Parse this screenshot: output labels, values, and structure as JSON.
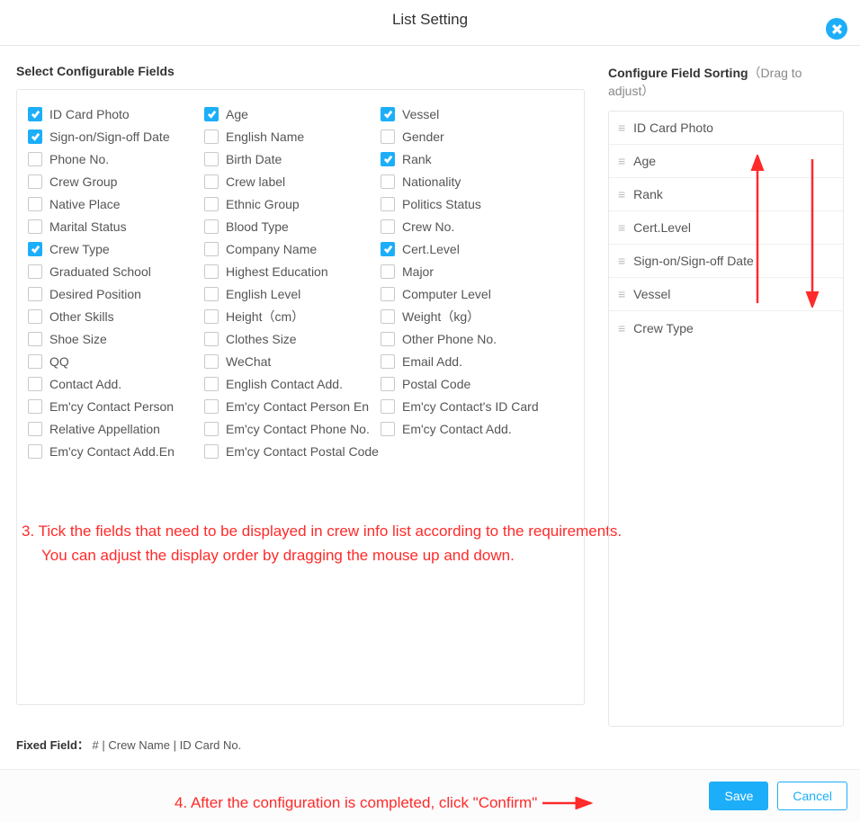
{
  "title": "List Setting",
  "leftPanelTitle": "Select Configurable Fields",
  "rightPanelTitle": "Configure Field Sorting",
  "rightPanelHint": "（Drag to adjust）",
  "columns": [
    [
      {
        "label": "ID Card Photo",
        "checked": true
      },
      {
        "label": "Sign-on/Sign-off Date",
        "checked": true
      },
      {
        "label": "Phone No.",
        "checked": false
      },
      {
        "label": "Crew Group",
        "checked": false
      },
      {
        "label": "Native Place",
        "checked": false
      },
      {
        "label": "Marital Status",
        "checked": false
      },
      {
        "label": "Crew Type",
        "checked": true
      },
      {
        "label": "Graduated School",
        "checked": false
      },
      {
        "label": "Desired Position",
        "checked": false
      },
      {
        "label": "Other Skills",
        "checked": false
      },
      {
        "label": "Shoe Size",
        "checked": false
      },
      {
        "label": "QQ",
        "checked": false
      },
      {
        "label": "Contact Add.",
        "checked": false
      },
      {
        "label": "Em'cy Contact Person",
        "checked": false
      },
      {
        "label": "Relative Appellation",
        "checked": false
      },
      {
        "label": "Em'cy Contact Add.En",
        "checked": false
      }
    ],
    [
      {
        "label": "Age",
        "checked": true
      },
      {
        "label": "English Name",
        "checked": false
      },
      {
        "label": "Birth Date",
        "checked": false
      },
      {
        "label": "Crew label",
        "checked": false
      },
      {
        "label": "Ethnic Group",
        "checked": false
      },
      {
        "label": "Blood Type",
        "checked": false
      },
      {
        "label": "Company Name",
        "checked": false
      },
      {
        "label": "Highest Education",
        "checked": false
      },
      {
        "label": "English Level",
        "checked": false
      },
      {
        "label": "Height（cm）",
        "checked": false
      },
      {
        "label": "Clothes Size",
        "checked": false
      },
      {
        "label": "WeChat",
        "checked": false
      },
      {
        "label": "English Contact Add.",
        "checked": false
      },
      {
        "label": "Em'cy Contact Person En",
        "checked": false
      },
      {
        "label": "Em'cy Contact Phone No.",
        "checked": false
      },
      {
        "label": "Em'cy Contact Postal Code",
        "checked": false
      }
    ],
    [
      {
        "label": "Vessel",
        "checked": true
      },
      {
        "label": "Gender",
        "checked": false
      },
      {
        "label": "Rank",
        "checked": true
      },
      {
        "label": "Nationality",
        "checked": false
      },
      {
        "label": "Politics Status",
        "checked": false
      },
      {
        "label": "Crew No.",
        "checked": false
      },
      {
        "label": "Cert.Level",
        "checked": true
      },
      {
        "label": "Major",
        "checked": false
      },
      {
        "label": "Computer Level",
        "checked": false
      },
      {
        "label": "Weight（kg）",
        "checked": false
      },
      {
        "label": "Other Phone No.",
        "checked": false
      },
      {
        "label": "Email Add.",
        "checked": false
      },
      {
        "label": "Postal Code",
        "checked": false
      },
      {
        "label": "Em'cy Contact's ID Card",
        "checked": false
      },
      {
        "label": "Em'cy Contact Add.",
        "checked": false
      }
    ]
  ],
  "sortItems": [
    "ID Card Photo",
    "Age",
    "Rank",
    "Cert.Level",
    "Sign-on/Sign-off Date",
    "Vessel",
    "Crew Type"
  ],
  "fixedFieldLabel": "Fixed Field：",
  "fixedFieldValues": "# | Crew Name | ID Card No.",
  "annotation3_line1": "3. Tick the fields that need to be displayed in crew info list according to the requirements.",
  "annotation3_line2": "You can adjust the display order by dragging the mouse up and down.",
  "annotation4": "4. After the configuration is completed, click \"Confirm\"",
  "saveLabel": "Save",
  "cancelLabel": "Cancel"
}
